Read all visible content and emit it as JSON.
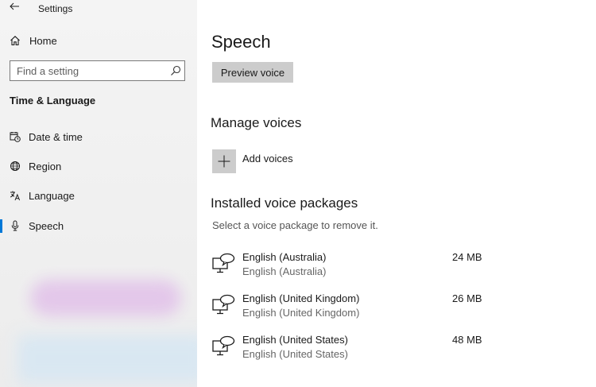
{
  "window": {
    "title": "Settings"
  },
  "sidebar": {
    "home_label": "Home",
    "search": {
      "placeholder": "Find a setting",
      "value": ""
    },
    "section_title": "Time & Language",
    "items": [
      {
        "label": "Date & time",
        "icon": "calendar-clock-icon"
      },
      {
        "label": "Region",
        "icon": "globe-icon"
      },
      {
        "label": "Language",
        "icon": "language-icon"
      },
      {
        "label": "Speech",
        "icon": "microphone-icon",
        "selected": true
      }
    ],
    "accent_color": "#0078d7"
  },
  "main": {
    "title": "Speech",
    "preview_button": "Preview voice",
    "manage_heading": "Manage voices",
    "add_voices_label": "Add voices",
    "installed_heading": "Installed voice packages",
    "installed_hint": "Select a voice package to remove it.",
    "voice_packages": [
      {
        "name": "English (Australia)",
        "subtitle": "English (Australia)",
        "size": "24 MB"
      },
      {
        "name": "English (United Kingdom)",
        "subtitle": "English (United Kingdom)",
        "size": "26 MB"
      },
      {
        "name": "English (United States)",
        "subtitle": "English (United States)",
        "size": "48 MB"
      }
    ]
  }
}
